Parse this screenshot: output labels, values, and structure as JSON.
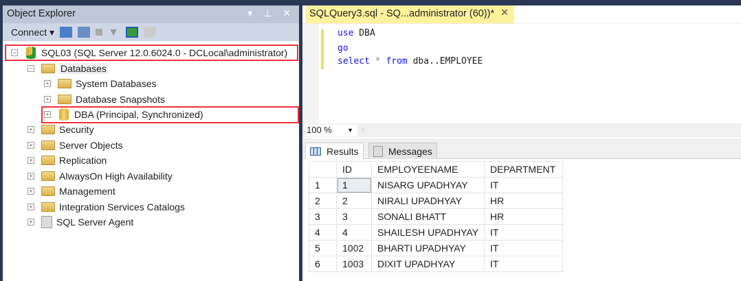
{
  "object_explorer": {
    "title": "Object Explorer",
    "controls": "▾ ⊥ ✕",
    "connect_label": "Connect ▾",
    "server": "SQL03 (SQL Server 12.0.6024.0 - DCLocal\\administrator)",
    "nodes": [
      "Databases",
      "System Databases",
      "Database Snapshots",
      "DBA (Principal, Synchronized)",
      "Security",
      "Server Objects",
      "Replication",
      "AlwaysOn High Availability",
      "Management",
      "Integration Services Catalogs",
      "SQL Server Agent"
    ]
  },
  "editor": {
    "tab_title": "SQLQuery3.sql - SQ...administrator (60))*",
    "close": "✕",
    "lines": [
      {
        "kw": "use",
        "rest": " DBA"
      },
      {
        "kw": "go",
        "rest": ""
      },
      {
        "kw": "select",
        "rest": " * ",
        "kw2": "from",
        "rest2": " dba..EMPLOYEE"
      }
    ],
    "zoom": "100 %"
  },
  "results": {
    "tabs": [
      "Results",
      "Messages"
    ],
    "columns": [
      "",
      "ID",
      "EMPLOYEENAME",
      "DEPARTMENT"
    ],
    "rows": [
      [
        "1",
        "1",
        "NISARG UPADHYAY",
        "IT"
      ],
      [
        "2",
        "2",
        "NIRALI UPADHYAY",
        "HR"
      ],
      [
        "3",
        "3",
        "SONALI BHATT",
        "HR"
      ],
      [
        "4",
        "4",
        "SHAILESH UPADHYAY",
        "IT"
      ],
      [
        "5",
        "1002",
        "BHARTI UPADHYAY",
        "IT"
      ],
      [
        "6",
        "1003",
        "DIXIT UPADHYAY",
        "IT"
      ]
    ]
  }
}
